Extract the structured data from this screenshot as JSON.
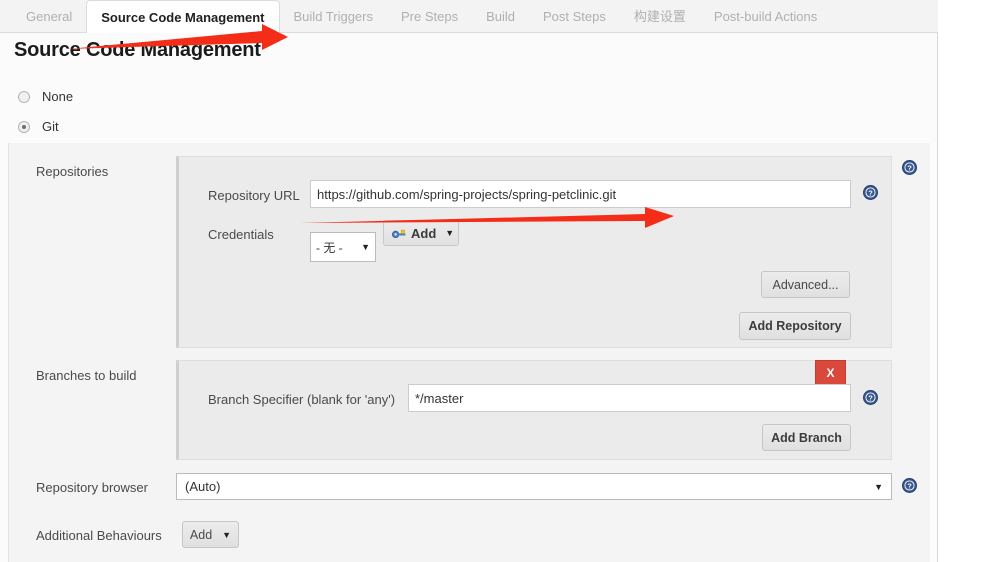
{
  "tabs": [
    {
      "label": "General",
      "active": false
    },
    {
      "label": "Source Code Management",
      "active": true
    },
    {
      "label": "Build Triggers",
      "active": false
    },
    {
      "label": "Pre Steps",
      "active": false
    },
    {
      "label": "Build",
      "active": false
    },
    {
      "label": "Post Steps",
      "active": false
    },
    {
      "label": "构建设置",
      "active": false
    },
    {
      "label": "Post-build Actions",
      "active": false
    }
  ],
  "page": {
    "title": "Source Code Management"
  },
  "scm_options": [
    {
      "label": "None",
      "selected": false
    },
    {
      "label": "Git",
      "selected": true
    }
  ],
  "repositories": {
    "section_label": "Repositories",
    "url_label": "Repository URL",
    "url_value": "https://github.com/spring-projects/spring-petclinic.git",
    "credentials_label": "Credentials",
    "credentials_value": "- 无 -",
    "add_credentials_label": "Add",
    "advanced_label": "Advanced...",
    "add_repository_label": "Add Repository"
  },
  "branches": {
    "section_label": "Branches to build",
    "specifier_label": "Branch Specifier (blank for 'any')",
    "specifier_value": "*/master",
    "delete_label": "X",
    "add_branch_label": "Add Branch"
  },
  "repository_browser": {
    "label": "Repository browser",
    "value": "(Auto)"
  },
  "additional_behaviours": {
    "label": "Additional Behaviours",
    "add_label": "Add"
  },
  "icons": {
    "help": "help-icon",
    "key": "key-icon",
    "caret_down": "▼"
  },
  "colors": {
    "accent_red": "#f42d18",
    "delete_red": "#d9483b",
    "help_blue": "#39578f",
    "panel_bg": "#ebebeb"
  }
}
